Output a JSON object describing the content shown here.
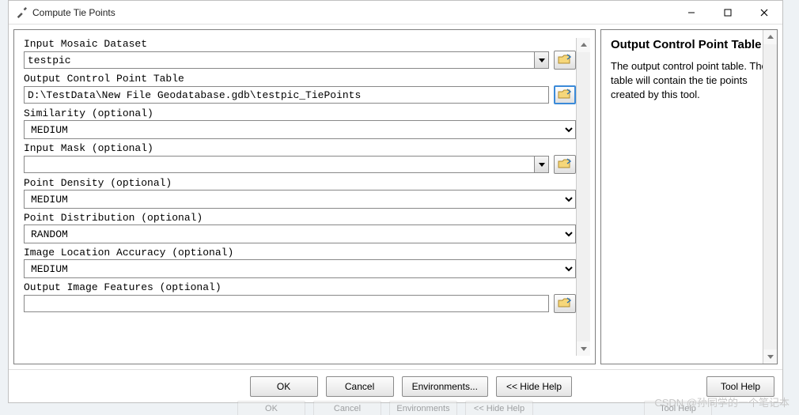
{
  "window": {
    "title": "Compute Tie Points"
  },
  "fields": {
    "mosaic_label": "Input Mosaic Dataset",
    "mosaic_value": "testpic",
    "output_table_label": "Output Control Point Table",
    "output_table_value": "D:\\TestData\\New File Geodatabase.gdb\\testpic_TiePoints",
    "similarity_label": "Similarity (optional)",
    "similarity_value": "MEDIUM",
    "mask_label": "Input Mask (optional)",
    "mask_value": "",
    "density_label": "Point Density (optional)",
    "density_value": "MEDIUM",
    "distribution_label": "Point Distribution (optional)",
    "distribution_value": "RANDOM",
    "accuracy_label": "Image Location Accuracy (optional)",
    "accuracy_value": "MEDIUM",
    "features_label": "Output Image Features (optional)",
    "features_value": ""
  },
  "help": {
    "title": "Output Control Point Table",
    "body": "The output control point table. The table will contain the tie points created by this tool."
  },
  "buttons": {
    "ok": "OK",
    "cancel": "Cancel",
    "env": "Environments...",
    "hide": "<< Hide Help",
    "toolhelp": "Tool Help"
  },
  "watermark": "CSDN @孙同学的一个笔记本",
  "ghost": {
    "ok": "OK",
    "cancel": "Cancel",
    "env": "Environments",
    "hide": "<< Hide Help",
    "toolhelp": "Tool Help"
  }
}
